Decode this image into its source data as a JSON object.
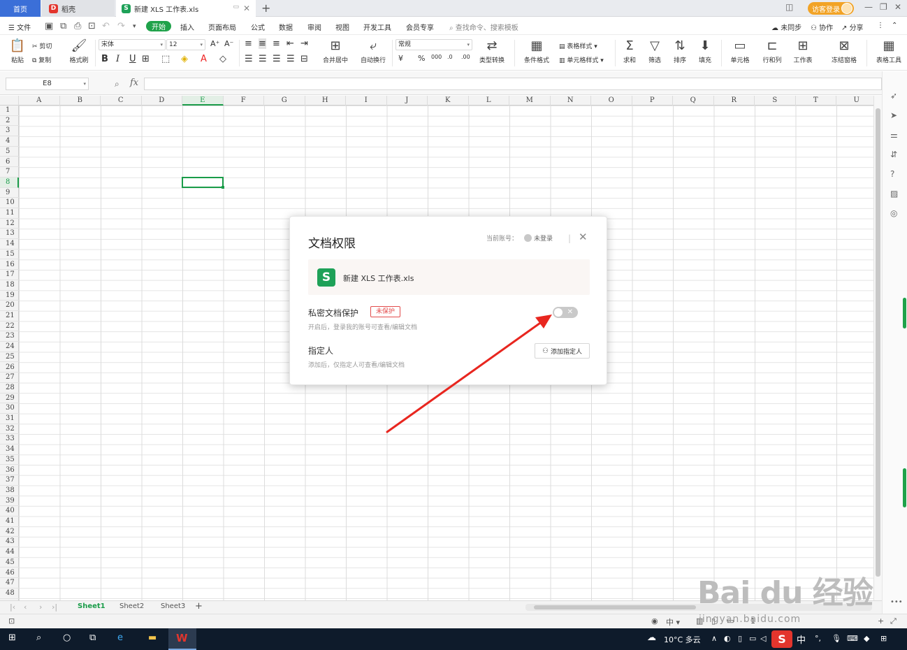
{
  "tabbar": {
    "home": "首页",
    "daoke": "稻壳",
    "doc": "新建 XLS 工作表.xls",
    "login": "访客登录"
  },
  "menu": {
    "file": "文件",
    "start": "开始",
    "items": [
      "插入",
      "页面布局",
      "公式",
      "数据",
      "审阅",
      "视图",
      "开发工具",
      "会员专享"
    ],
    "search": "查找命令、搜索模板",
    "sync": "未同步",
    "collab": "协作",
    "share": "分享"
  },
  "ribbon": {
    "paste": "粘贴",
    "cut": "剪切",
    "copy": "复制",
    "format_painter": "格式刷",
    "font_name": "宋体",
    "font_size": "12",
    "number_format": "常规",
    "merge": "合并居中",
    "wrap": "自动换行",
    "type_convert": "类型转换",
    "cond_format": "条件格式",
    "table_style": "表格样式",
    "cell_style": "单元格样式",
    "sum": "求和",
    "filter": "筛选",
    "sort": "排序",
    "fill": "填充",
    "cell": "单元格",
    "row_col": "行和列",
    "sheet": "工作表",
    "freeze": "冻结窗格",
    "table_tools": "表格工具"
  },
  "formula": {
    "cell_ref": "E8",
    "fx": "fx"
  },
  "grid": {
    "columns": [
      "A",
      "B",
      "C",
      "D",
      "E",
      "F",
      "G",
      "H",
      "I",
      "J",
      "K",
      "L",
      "M",
      "N",
      "O",
      "P",
      "Q",
      "R",
      "S",
      "T",
      "U"
    ],
    "selected_column": "E",
    "selected_row": 8,
    "row_count": 48
  },
  "sheets": {
    "tabs": [
      "Sheet1",
      "Sheet2",
      "Sheet3"
    ],
    "active": "Sheet1"
  },
  "statusbar": {
    "ime": "中",
    "zoom": "1"
  },
  "taskbar": {
    "weather": "10°C 多云",
    "ime": "中"
  },
  "dialog": {
    "title": "文档权限",
    "account_label": "当前账号：",
    "account_value": "未登录",
    "file_name": "新建 XLS 工作表.xls",
    "private_label": "私密文档保护",
    "private_badge": "未保护",
    "private_desc": "开启后，登录我的账号可查看/编辑文档",
    "private_enabled": false,
    "assign_label": "指定人",
    "assign_desc": "添加后，仅指定人可查看/编辑文档",
    "assign_button": "添加指定人"
  },
  "watermark": {
    "brand": "Bai du 经验",
    "url": "jingyan.baidu.com"
  },
  "colors": {
    "accent_green": "#1fa24a",
    "tab_blue": "#3b6fd8",
    "badge_red": "#e24b4b",
    "arrow_red": "#e8261f"
  }
}
